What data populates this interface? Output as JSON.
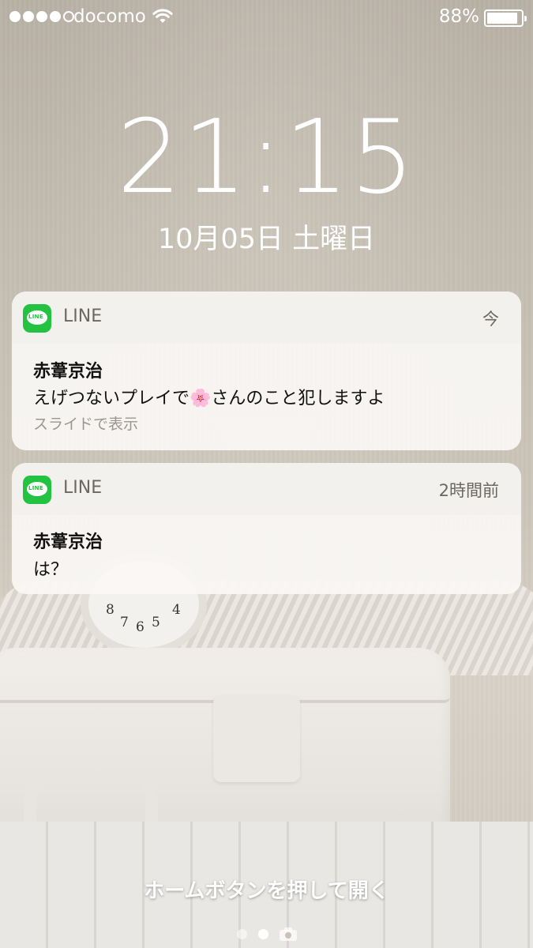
{
  "status_bar": {
    "signal_bars_filled": 4,
    "signal_bars_total": 5,
    "carrier": "docomo",
    "wifi_icon": "wifi-icon",
    "battery_percent": "88%",
    "battery_level": 0.88
  },
  "lock_screen": {
    "time": "21:15",
    "date": "10月05日 土曜日"
  },
  "notifications": [
    {
      "app_icon": "line-app-icon",
      "app_name": "LINE",
      "time": "今",
      "sender": "赤葦京治",
      "message_before": "えげつないプレイで",
      "message_emoji": "🌸",
      "message_after": "さんのこと犯しますよ",
      "hint": "スライドで表示"
    },
    {
      "app_icon": "line-app-icon",
      "app_name": "LINE",
      "time": "2時間前",
      "sender": "赤葦京治",
      "message": "は？"
    }
  ],
  "home_hint": "ホームボタンを押して開く",
  "page_indicator": {
    "dots": 2,
    "active_index": 1,
    "camera_icon": "camera-icon"
  },
  "wallpaper_clock_numbers": [
    "8",
    "7",
    "6",
    "5",
    "4"
  ]
}
